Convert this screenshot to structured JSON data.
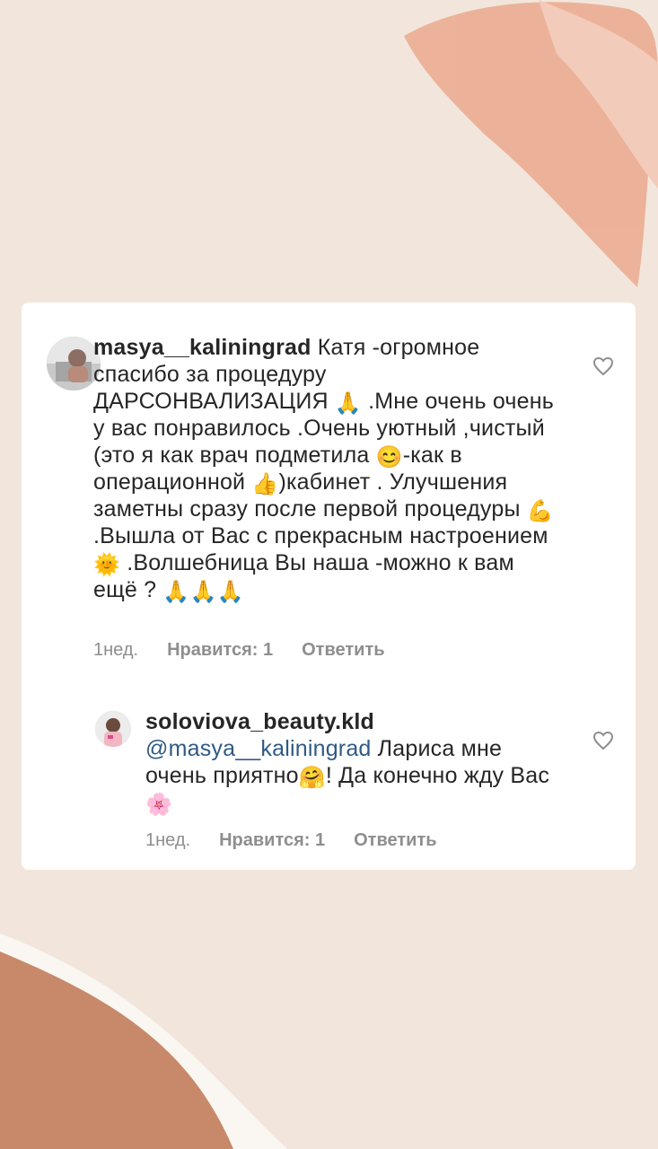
{
  "comments": {
    "main": {
      "username": "masya__kaliningrad",
      "segments": [
        " Катя -огромное спасибо за процедуру ДАРСОНВАЛИЗАЦИЯ ",
        " .Мне очень очень у вас понравилось .Очень уютный ,чистый (это я как врач подметила ",
        "-как в операционной ",
        ")кабинет . Улучшения заметны сразу после первой процедуры ",
        ".Вышла от Вас с прекрасным настроением ",
        " .Волшебница Вы наша -можно к вам ещё ? "
      ],
      "emojis": {
        "pray": "🙏",
        "smile": "😊",
        "thumbs": "👍",
        "muscle": "💪",
        "sun": "🌞",
        "pray_triple": "🙏🙏🙏"
      },
      "time": "1нед.",
      "likes": "Нравится: 1",
      "reply": "Ответить"
    },
    "reply": {
      "username": "soloviova_beauty.kld",
      "mention": "@masya__kaliningrad",
      "segments": [
        " Лариса мне очень приятно",
        "! Да конечно жду Вас "
      ],
      "emojis": {
        "hug": "🤗",
        "flower": "🌸"
      },
      "time": "1нед.",
      "likes": "Нравится: 1",
      "reply": "Ответить"
    }
  },
  "colors": {
    "background": "#f2e6dc",
    "card": "#ffffff",
    "text": "#262626",
    "meta": "#8e8e8e",
    "mention": "#2f5a85",
    "brush_top": "#eba98e",
    "brush_bottom": "#c8896a"
  },
  "icons": {
    "like_main": "heart-outline-icon",
    "like_reply": "heart-outline-icon"
  }
}
